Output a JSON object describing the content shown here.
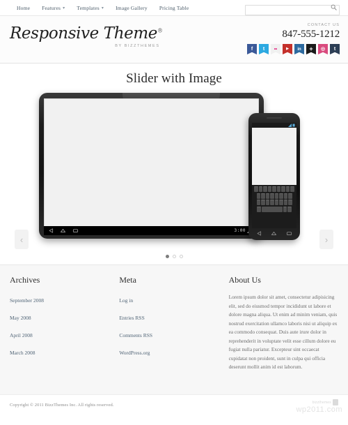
{
  "topnav": {
    "items": [
      {
        "label": "Home",
        "has_dropdown": false
      },
      {
        "label": "Features",
        "has_dropdown": true
      },
      {
        "label": "Templates",
        "has_dropdown": true
      },
      {
        "label": "Image Gallery",
        "has_dropdown": false
      },
      {
        "label": "Pricing Table",
        "has_dropdown": false
      }
    ],
    "caret": "▾"
  },
  "search": {
    "value": "",
    "placeholder": ""
  },
  "header": {
    "logo_main": "Responsive Theme",
    "logo_registered": "®",
    "logo_sub": "BY BIZZTHEMES",
    "contact_label": "CONTACT US",
    "phone": "847-555-1212",
    "socials": [
      {
        "name": "facebook-icon",
        "glyph": "f",
        "color": "#3b5998"
      },
      {
        "name": "twitter-icon",
        "glyph": "t",
        "color": "#2ca9e1"
      },
      {
        "name": "flickr-icon",
        "glyph": "••",
        "color": "#f0f0f0"
      },
      {
        "name": "youtube-icon",
        "glyph": "▶",
        "color": "#c4302b"
      },
      {
        "name": "linkedin-icon",
        "glyph": "in",
        "color": "#2d6a9f"
      },
      {
        "name": "googleplus-icon",
        "glyph": "+",
        "color": "#1a1a1a"
      },
      {
        "name": "instagram-icon",
        "glyph": "◎",
        "color": "#d94b7e"
      },
      {
        "name": "tumblr-icon",
        "glyph": "t",
        "color": "#2c3e55"
      }
    ]
  },
  "slider": {
    "title": "Slider with Image",
    "prev_label": "‹",
    "next_label": "›",
    "dots": [
      {
        "active": true
      },
      {
        "active": false
      },
      {
        "active": false
      }
    ],
    "tablet": {
      "status_time": "3:00",
      "nav_back": "back-icon",
      "nav_home": "home-icon",
      "nav_recents": "recents-icon"
    },
    "phone": {
      "keyboard": "android-keyboard"
    }
  },
  "footer": {
    "columns": [
      {
        "title": "Archives",
        "links": [
          "September 2008",
          "May 2008",
          "April 2008",
          "March 2008"
        ]
      },
      {
        "title": "Meta",
        "links": [
          "Log in",
          "Entries RSS",
          "Comments RSS",
          "WordPress.org"
        ]
      }
    ],
    "about": {
      "title": "About Us",
      "text": "Lorem ipsum dolor sit amet, consectetur adipisicing elit, sed do eiusmod tempor incididunt ut labore et dolore magna aliqua. Ut enim ad minim veniam, quis nostrud exercitation ullamco laboris nisi ut aliquip ex ea commodo consequat. Duis aute irure dolor in reprehenderit in voluptate velit esse cillum dolore eu fugiat nulla pariatur. Excepteur sint occaecat cupidatat non proident, sunt in culpa qui officia deserunt mollit anim id est laborum."
    }
  },
  "copyright": {
    "text": "Copyright © 2011 BizzThemes Inc. All rights reserved.",
    "brand": "bizzthemes",
    "watermark": "wp2011.com"
  }
}
